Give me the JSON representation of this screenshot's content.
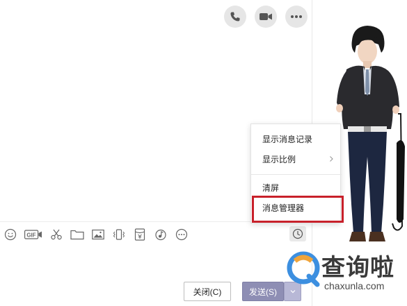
{
  "top_icons": [
    {
      "name": "phone-icon"
    },
    {
      "name": "video-camera-icon"
    },
    {
      "name": "more-icon"
    }
  ],
  "toolbar": [
    {
      "name": "emoji-icon"
    },
    {
      "name": "gif-icon",
      "label": "GIF"
    },
    {
      "name": "scissors-icon"
    },
    {
      "name": "folder-icon"
    },
    {
      "name": "image-icon"
    },
    {
      "name": "vibrate-icon"
    },
    {
      "name": "red-packet-icon"
    },
    {
      "name": "music-icon"
    },
    {
      "name": "more-circle-icon"
    }
  ],
  "menu": {
    "items": [
      {
        "label": "显示消息记录"
      },
      {
        "label": "显示比例",
        "has_submenu": true
      },
      {
        "label": "清屏"
      },
      {
        "label": "消息管理器",
        "highlighted": true
      }
    ]
  },
  "footer": {
    "close_label": "关闭(C)",
    "send_label": "发送(S)"
  },
  "watermark": {
    "cn": "查询啦",
    "en": "chaxunla.com"
  },
  "colors": {
    "highlight_border": "#c8202a",
    "send_button": "#8e8eb4",
    "icon_bg": "#e6e6e6"
  }
}
